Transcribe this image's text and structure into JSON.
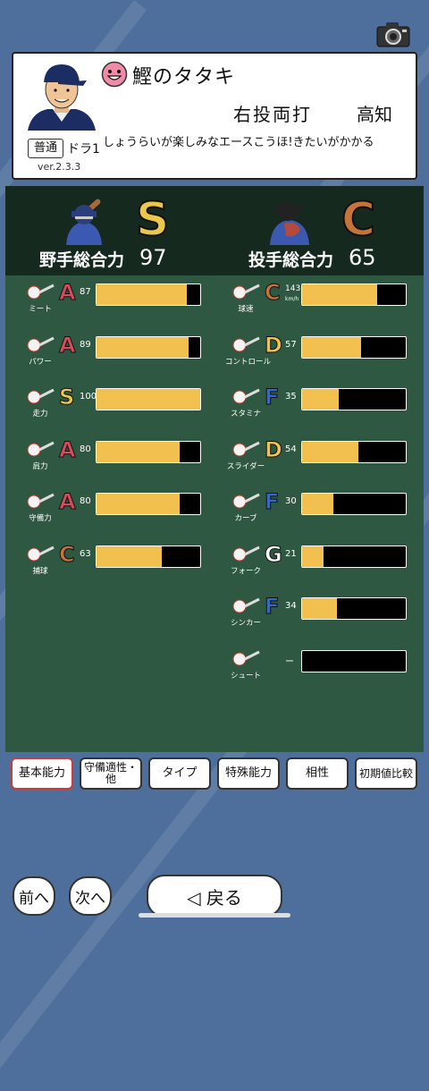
{
  "player": {
    "name": "鰹のタタキ",
    "hand": "右投両打",
    "team": "高知",
    "type_tag": "普通",
    "draft": "ドラ1",
    "version": "ver.2.3.3",
    "catch_phrase": "しょうらいが楽しみなエースこうほ!きたいがかかる"
  },
  "colors": {
    "grade_S": "#ecc84a",
    "grade_A": "#d64c5a",
    "grade_C": "#c4733a",
    "grade_D": "#f3c24a",
    "grade_F": "#2d6bd1",
    "grade_G": "#ffffff",
    "bar_fill": "#f1c04e",
    "panel": "#2f5842",
    "background": "#4e6f9b"
  },
  "fielder": {
    "label": "野手総合力",
    "grade": "S",
    "value": "97"
  },
  "pitcher": {
    "label": "投手総合力",
    "grade": "C",
    "value": "65"
  },
  "batting_stats": [
    {
      "label": "ミート",
      "grade": "A",
      "value": "87",
      "fill": 0.87,
      "icon": "bat-icon"
    },
    {
      "label": "パワー",
      "grade": "A",
      "value": "89",
      "fill": 0.89,
      "icon": "power-icon"
    },
    {
      "label": "走力",
      "grade": "S",
      "value": "100",
      "fill": 1.0,
      "icon": "runner-icon"
    },
    {
      "label": "肩力",
      "grade": "A",
      "value": "80",
      "fill": 0.8,
      "icon": "throw-icon"
    },
    {
      "label": "守備力",
      "grade": "A",
      "value": "80",
      "fill": 0.8,
      "icon": "glove-icon"
    },
    {
      "label": "捕球",
      "grade": "C",
      "value": "63",
      "fill": 0.63,
      "icon": "catch-icon"
    }
  ],
  "pitching_stats": [
    {
      "label": "球速",
      "grade": "C",
      "value": "143",
      "unit": "km/h",
      "fill": 0.72,
      "icon": "fastball-icon"
    },
    {
      "label": "コントロール",
      "grade": "D",
      "value": "57",
      "fill": 0.57,
      "icon": "control-icon"
    },
    {
      "label": "スタミナ",
      "grade": "F",
      "value": "35",
      "fill": 0.35,
      "icon": "riceball-icon"
    },
    {
      "label": "スライダー",
      "grade": "D",
      "value": "54",
      "fill": 0.54,
      "icon": "slider-icon"
    },
    {
      "label": "カーブ",
      "grade": "F",
      "value": "30",
      "fill": 0.3,
      "icon": "curve-icon"
    },
    {
      "label": "フォーク",
      "grade": "G",
      "value": "21",
      "fill": 0.21,
      "icon": "fork-icon"
    },
    {
      "label": "シンカー",
      "grade": "F",
      "value": "34",
      "fill": 0.34,
      "icon": "sinker-icon"
    },
    {
      "label": "シュート",
      "grade": "",
      "value": "ー",
      "fill": 0,
      "icon": "shoot-icon"
    }
  ],
  "tabs": [
    "基本能力",
    "守備適性・他",
    "タイプ",
    "特殊能力",
    "相性",
    "初期値比較"
  ],
  "nav": {
    "prev": "前へ",
    "next": "次へ",
    "back": "◁ 戻る"
  }
}
